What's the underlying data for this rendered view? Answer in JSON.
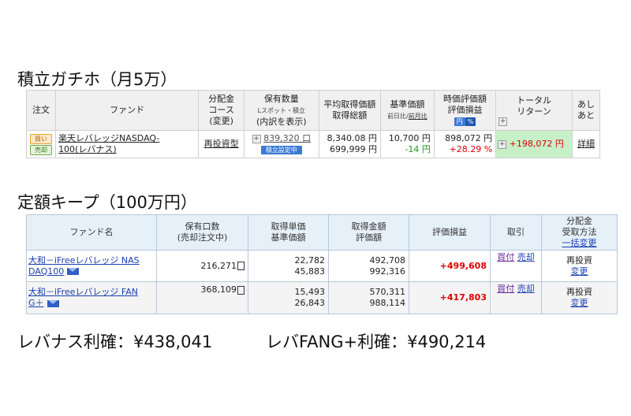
{
  "section1": {
    "title": "積立ガチホ（月5万）",
    "headers": {
      "order": "注文",
      "fund": "ファンド",
      "dist_1": "分配金",
      "dist_2": "コース",
      "dist_3": "(変更)",
      "qty_1": "保有数量",
      "qty_2": "Lスポット・積立",
      "qty_3": "(内訳を表示)",
      "avg_1": "平均取得価額",
      "avg_2": "取得総額",
      "base_1": "基準価額",
      "base_2a": "前日比",
      "base_2sep": "/",
      "base_2b": "前月比",
      "eval_1": "時価評価額",
      "eval_2": "評価損益",
      "eval_yen": "円",
      "eval_pct": "%",
      "total_1": "トータル",
      "total_2": "リターン",
      "ashi_1": "あし",
      "ashi_2": "あと"
    },
    "row": {
      "buy_label": "買い",
      "sell_label": "売却",
      "fund_name_1": "楽天レバレッジNASDAQ-",
      "fund_name_2": "100(レバナス)",
      "course": "再投資型",
      "qty": "839,320 口",
      "tsumitate_badge": "積立設定中",
      "avg_price": "8,340.08 円",
      "total_cost": "699,999 円",
      "base_price": "10,700 円",
      "base_change": "-14 円",
      "market_value": "898,072 円",
      "pl_pct": "+28.29 %",
      "total_return": "+198,072 円",
      "detail": "詳細"
    }
  },
  "section2": {
    "title": "定額キープ（100万円）",
    "headers": {
      "fund": "ファンド名",
      "hold_1": "保有口数",
      "hold_2": "(売却注文中)",
      "unit_1": "取得単価",
      "unit_2": "基準価額",
      "amt_1": "取得金額",
      "amt_2": "評価額",
      "pl": "評価損益",
      "trade": "取引",
      "recv_1": "分配金",
      "recv_2": "受取方法",
      "recv_3": "一括変更"
    },
    "rows": [
      {
        "fund_1": "大和－iFreeレバレッジ NAS",
        "fund_2": "DAQ100",
        "units": "216,271",
        "unit_price": "22,782",
        "base_price": "45,883",
        "cost": "492,708",
        "value": "992,316",
        "pl": "+499,608",
        "buy": "買付",
        "sell": "売却",
        "reinvest": "再投資",
        "change": "変更"
      },
      {
        "fund_1": "大和－iFreeレバレッジ FAN",
        "fund_2": "G＋",
        "units": "368,109",
        "unit_price": "15,493",
        "base_price": "26,843",
        "cost": "570,311",
        "value": "988,114",
        "pl": "+417,803",
        "buy": "買付",
        "sell": "売却",
        "reinvest": "再投資",
        "change": "変更"
      }
    ]
  },
  "summary": {
    "levanas": "レバナス利確：¥438,041",
    "fang": "レバFANG+利確：¥490,214"
  }
}
